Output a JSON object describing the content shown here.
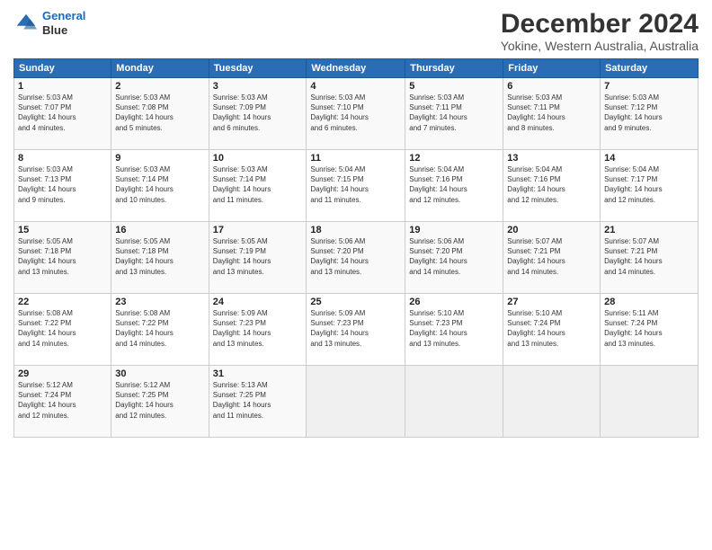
{
  "header": {
    "logo_line1": "General",
    "logo_line2": "Blue",
    "month_title": "December 2024",
    "location": "Yokine, Western Australia, Australia"
  },
  "weekdays": [
    "Sunday",
    "Monday",
    "Tuesday",
    "Wednesday",
    "Thursday",
    "Friday",
    "Saturday"
  ],
  "weeks": [
    [
      {
        "day": "1",
        "info": "Sunrise: 5:03 AM\nSunset: 7:07 PM\nDaylight: 14 hours\nand 4 minutes."
      },
      {
        "day": "2",
        "info": "Sunrise: 5:03 AM\nSunset: 7:08 PM\nDaylight: 14 hours\nand 5 minutes."
      },
      {
        "day": "3",
        "info": "Sunrise: 5:03 AM\nSunset: 7:09 PM\nDaylight: 14 hours\nand 6 minutes."
      },
      {
        "day": "4",
        "info": "Sunrise: 5:03 AM\nSunset: 7:10 PM\nDaylight: 14 hours\nand 6 minutes."
      },
      {
        "day": "5",
        "info": "Sunrise: 5:03 AM\nSunset: 7:11 PM\nDaylight: 14 hours\nand 7 minutes."
      },
      {
        "day": "6",
        "info": "Sunrise: 5:03 AM\nSunset: 7:11 PM\nDaylight: 14 hours\nand 8 minutes."
      },
      {
        "day": "7",
        "info": "Sunrise: 5:03 AM\nSunset: 7:12 PM\nDaylight: 14 hours\nand 9 minutes."
      }
    ],
    [
      {
        "day": "8",
        "info": "Sunrise: 5:03 AM\nSunset: 7:13 PM\nDaylight: 14 hours\nand 9 minutes."
      },
      {
        "day": "9",
        "info": "Sunrise: 5:03 AM\nSunset: 7:14 PM\nDaylight: 14 hours\nand 10 minutes."
      },
      {
        "day": "10",
        "info": "Sunrise: 5:03 AM\nSunset: 7:14 PM\nDaylight: 14 hours\nand 11 minutes."
      },
      {
        "day": "11",
        "info": "Sunrise: 5:04 AM\nSunset: 7:15 PM\nDaylight: 14 hours\nand 11 minutes."
      },
      {
        "day": "12",
        "info": "Sunrise: 5:04 AM\nSunset: 7:16 PM\nDaylight: 14 hours\nand 12 minutes."
      },
      {
        "day": "13",
        "info": "Sunrise: 5:04 AM\nSunset: 7:16 PM\nDaylight: 14 hours\nand 12 minutes."
      },
      {
        "day": "14",
        "info": "Sunrise: 5:04 AM\nSunset: 7:17 PM\nDaylight: 14 hours\nand 12 minutes."
      }
    ],
    [
      {
        "day": "15",
        "info": "Sunrise: 5:05 AM\nSunset: 7:18 PM\nDaylight: 14 hours\nand 13 minutes."
      },
      {
        "day": "16",
        "info": "Sunrise: 5:05 AM\nSunset: 7:18 PM\nDaylight: 14 hours\nand 13 minutes."
      },
      {
        "day": "17",
        "info": "Sunrise: 5:05 AM\nSunset: 7:19 PM\nDaylight: 14 hours\nand 13 minutes."
      },
      {
        "day": "18",
        "info": "Sunrise: 5:06 AM\nSunset: 7:20 PM\nDaylight: 14 hours\nand 13 minutes."
      },
      {
        "day": "19",
        "info": "Sunrise: 5:06 AM\nSunset: 7:20 PM\nDaylight: 14 hours\nand 14 minutes."
      },
      {
        "day": "20",
        "info": "Sunrise: 5:07 AM\nSunset: 7:21 PM\nDaylight: 14 hours\nand 14 minutes."
      },
      {
        "day": "21",
        "info": "Sunrise: 5:07 AM\nSunset: 7:21 PM\nDaylight: 14 hours\nand 14 minutes."
      }
    ],
    [
      {
        "day": "22",
        "info": "Sunrise: 5:08 AM\nSunset: 7:22 PM\nDaylight: 14 hours\nand 14 minutes."
      },
      {
        "day": "23",
        "info": "Sunrise: 5:08 AM\nSunset: 7:22 PM\nDaylight: 14 hours\nand 14 minutes."
      },
      {
        "day": "24",
        "info": "Sunrise: 5:09 AM\nSunset: 7:23 PM\nDaylight: 14 hours\nand 13 minutes."
      },
      {
        "day": "25",
        "info": "Sunrise: 5:09 AM\nSunset: 7:23 PM\nDaylight: 14 hours\nand 13 minutes."
      },
      {
        "day": "26",
        "info": "Sunrise: 5:10 AM\nSunset: 7:23 PM\nDaylight: 14 hours\nand 13 minutes."
      },
      {
        "day": "27",
        "info": "Sunrise: 5:10 AM\nSunset: 7:24 PM\nDaylight: 14 hours\nand 13 minutes."
      },
      {
        "day": "28",
        "info": "Sunrise: 5:11 AM\nSunset: 7:24 PM\nDaylight: 14 hours\nand 13 minutes."
      }
    ],
    [
      {
        "day": "29",
        "info": "Sunrise: 5:12 AM\nSunset: 7:24 PM\nDaylight: 14 hours\nand 12 minutes."
      },
      {
        "day": "30",
        "info": "Sunrise: 5:12 AM\nSunset: 7:25 PM\nDaylight: 14 hours\nand 12 minutes."
      },
      {
        "day": "31",
        "info": "Sunrise: 5:13 AM\nSunset: 7:25 PM\nDaylight: 14 hours\nand 11 minutes."
      },
      {
        "day": "",
        "info": ""
      },
      {
        "day": "",
        "info": ""
      },
      {
        "day": "",
        "info": ""
      },
      {
        "day": "",
        "info": ""
      }
    ]
  ]
}
